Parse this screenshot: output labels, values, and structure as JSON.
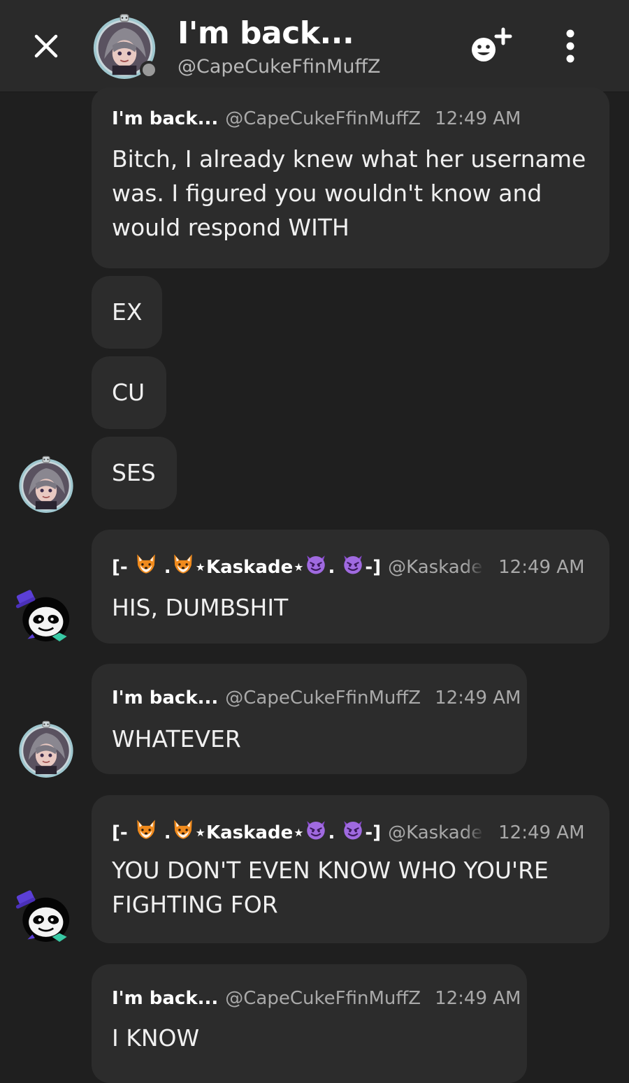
{
  "header": {
    "title": "I'm back...",
    "handle": "@CapeCukeFfinMuffZ"
  },
  "messages": [
    {
      "author": "I'm back...",
      "handle": "@CapeCukeFfinMuffZ",
      "time": "12:49 AM",
      "text": "Bitch, I already knew what her username was. I figured you wouldn't know and would respond WITH"
    },
    {
      "text": "EX"
    },
    {
      "text": "CU"
    },
    {
      "text": "SES"
    },
    {
      "author_prefix": "[- ",
      "author_mid": " .",
      "author_name": "⋆Kaskade⋆",
      "author_sep": ". ",
      "author_suffix": "-]",
      "handle": "@KaskadeF",
      "time": "12:49 AM",
      "text": "HIS, DUMBSHIT"
    },
    {
      "author": "I'm back...",
      "handle": "@CapeCukeFfinMuffZ",
      "time": "12:49 AM",
      "text": "WHATEVER"
    },
    {
      "author_prefix": "[- ",
      "author_mid": " .",
      "author_name": "⋆Kaskade⋆",
      "author_sep": ". ",
      "author_suffix": "-]",
      "handle": "@KaskadeF",
      "time": "12:49 AM",
      "text": "YOU DON'T EVEN KNOW WHO YOU'RE FIGHTING FOR"
    },
    {
      "author": "I'm back...",
      "handle": "@CapeCukeFfinMuffZ",
      "time": "12:49 AM",
      "text": "I KNOW"
    }
  ],
  "icons": {
    "close": "close-icon",
    "add_user": "add-user-icon",
    "more": "more-vertical-icon",
    "fox": "fox-emoji",
    "devil": "devil-emoji"
  },
  "colors": {
    "background": "#1f1f1f",
    "header": "#2a2a2a",
    "bubble": "#2c2c2c",
    "muted_text": "#a9a9a9"
  }
}
